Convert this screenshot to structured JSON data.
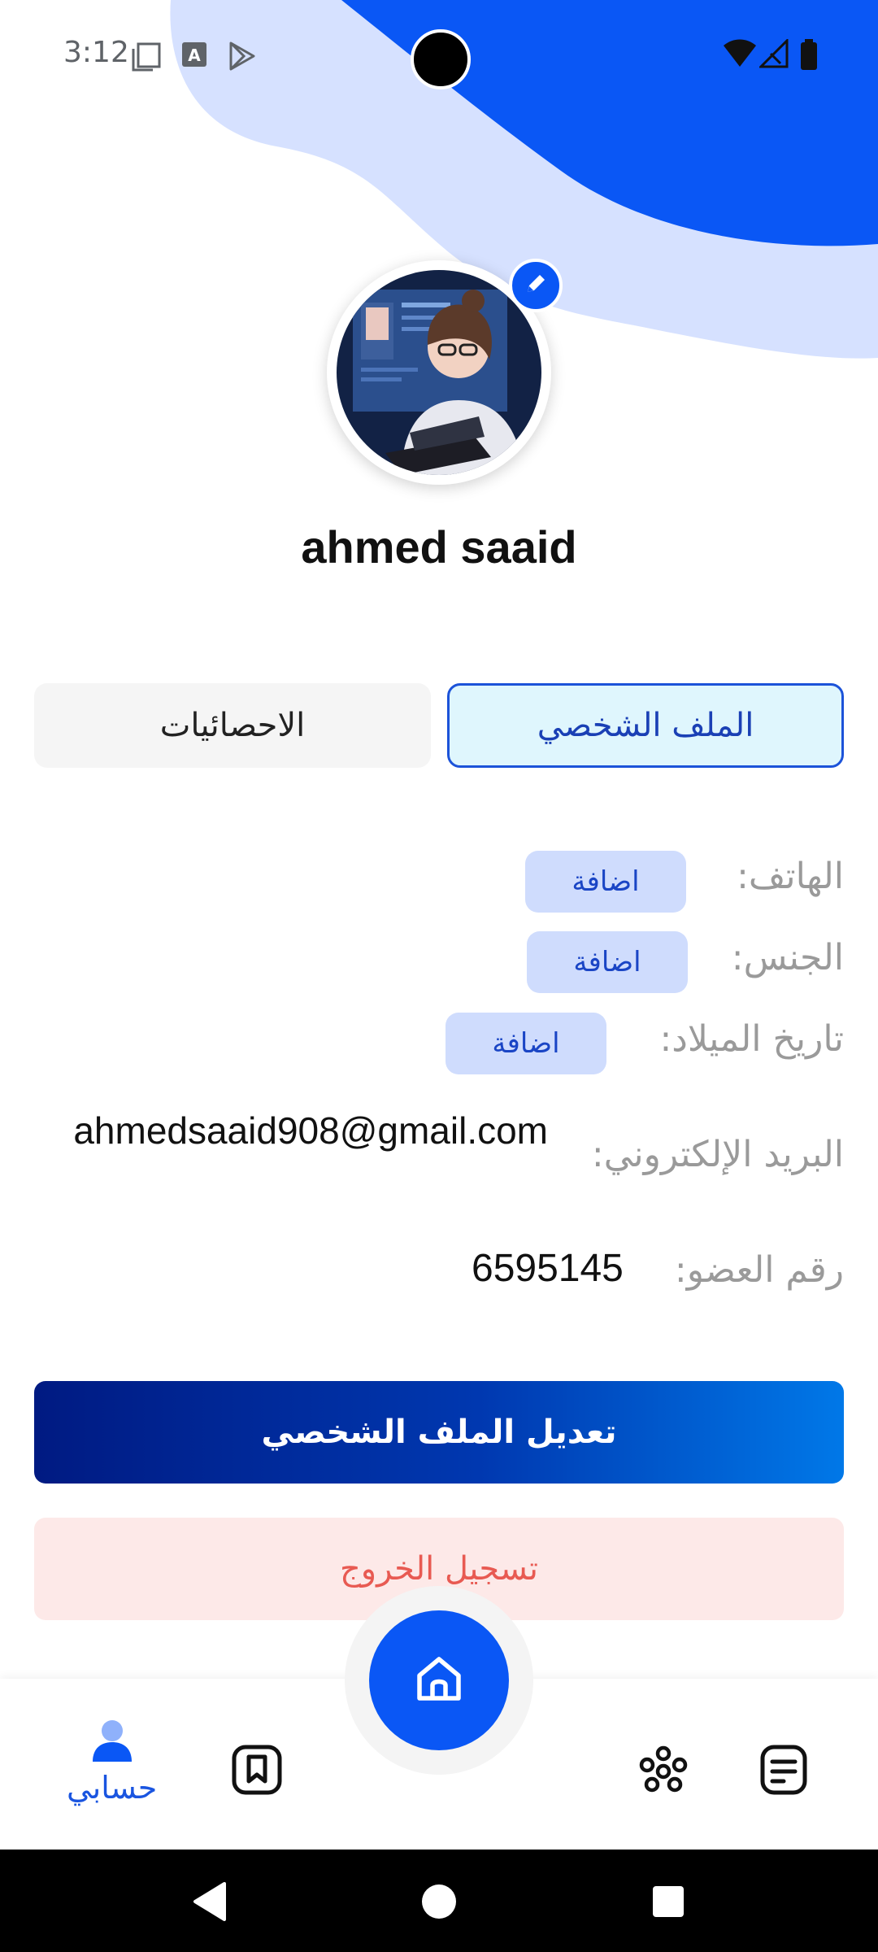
{
  "status_bar": {
    "time": "3:12"
  },
  "profile": {
    "username": "ahmed saaid"
  },
  "tabs": [
    {
      "label": "الملف الشخصي",
      "active": true
    },
    {
      "label": "الاحصائيات",
      "active": false
    }
  ],
  "info": {
    "phone_label": "الهاتف:",
    "gender_label": "الجنس:",
    "birthdate_label": "تاريخ الميلاد:",
    "email_label": "البريد الإلكتروني:",
    "email_value": "ahmedsaaid908@gmail.com",
    "member_label": "رقم العضو:",
    "member_value": "6595145",
    "add_label": "اضافة"
  },
  "actions": {
    "edit_profile": "تعديل الملف الشخصي",
    "logout": "تسجيل الخروج"
  },
  "bottom_nav": {
    "account_label": "حسابي"
  },
  "colors": {
    "primary": "#0a57f5",
    "logout_text": "#e85a52",
    "logout_bg": "#fde9e8",
    "tab_active_bg": "#dff6fd"
  }
}
